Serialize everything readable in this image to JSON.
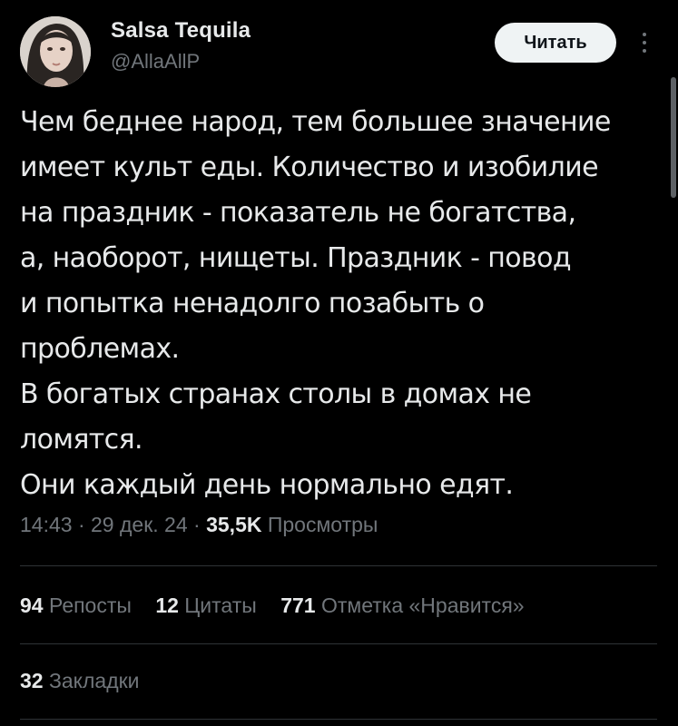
{
  "author": {
    "name": "Salsa Tequila",
    "handle": "@AllaAllP",
    "avatar_icon": "profile-photo"
  },
  "follow_label": "Читать",
  "more_icon": "more-vertical-icon",
  "tweet": {
    "lines": [
      "Чем беднее народ, тем большее значение",
      "имеет культ еды. Количество и изобилие",
      "на праздник - показатель не богатства,",
      "а, наоборот, нищеты. Праздник - повод",
      "и попытка ненадолго позабыть о",
      "проблемах.",
      "В богатых странах столы в домах не",
      "ломятся.",
      "Они каждый день нормально едят."
    ]
  },
  "meta": {
    "time": "14:43",
    "separator": " · ",
    "date": "29 дек. 24",
    "views_count": "35,5K",
    "views_label": "Просмотры"
  },
  "stats": {
    "reposts": {
      "count": "94",
      "label": "Репосты"
    },
    "quotes": {
      "count": "12",
      "label": "Цитаты"
    },
    "likes": {
      "count": "771",
      "label": "Отметка «Нравится»"
    },
    "bookmarks": {
      "count": "32",
      "label": "Закладки"
    }
  },
  "colors": {
    "background": "#000000",
    "text": "#e7e9ea",
    "secondary": "#71767b",
    "divider": "#2f3336",
    "button_bg": "#eff3f4"
  }
}
